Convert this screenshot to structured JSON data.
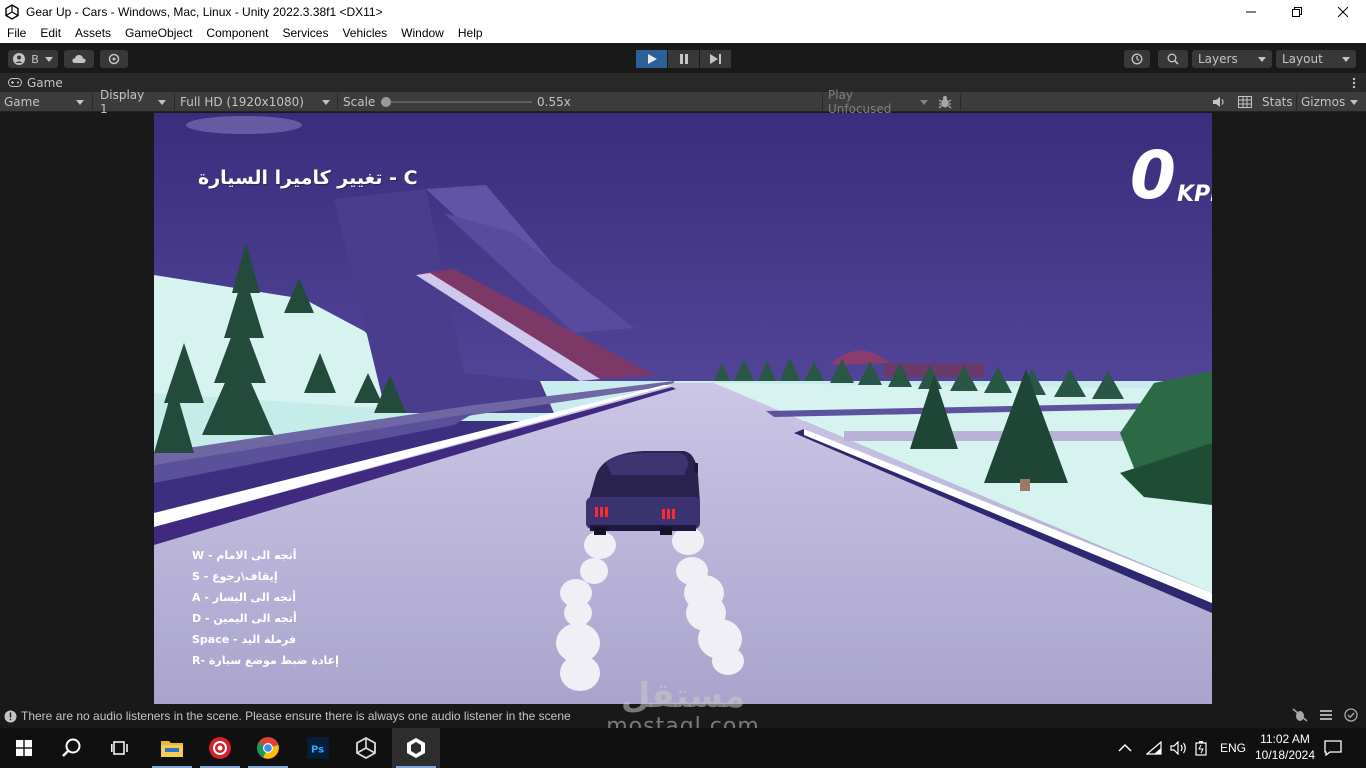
{
  "window": {
    "title": "Gear Up - Cars - Windows, Mac, Linux - Unity 2022.3.38f1 <DX11>"
  },
  "menu": [
    "File",
    "Edit",
    "Assets",
    "GameObject",
    "Component",
    "Services",
    "Vehicles",
    "Window",
    "Help"
  ],
  "toolbar": {
    "account_initial": "B",
    "layers_label": "Layers",
    "layout_label": "Layout"
  },
  "tab": {
    "label": "Game"
  },
  "gamebar": {
    "mode": "Game",
    "display": "Display 1",
    "resolution": "Full HD (1920x1080)",
    "scale_label": "Scale",
    "scale_value": "0.55x",
    "play_focus": "Play Unfocused",
    "stats": "Stats",
    "gizmos": "Gizmos"
  },
  "hud": {
    "camera_hint": "تغيير كاميرا السيارة - C",
    "speed_value": "0",
    "speed_unit": "KPH",
    "controls": [
      {
        "key": "W",
        "action": "أتجه الى الامام"
      },
      {
        "key": "S",
        "action": "إيقاف\\رجوع"
      },
      {
        "key": "A",
        "action": "أتجه الى اليسار"
      },
      {
        "key": "D",
        "action": "أتجه الى اليمين"
      },
      {
        "key": "Space",
        "action": "فرملة اليد"
      },
      {
        "key": "R",
        "action": "إعادة ضبط موضع سيارة"
      }
    ]
  },
  "status": {
    "message": "There are no audio listeners in the scene. Please ensure there is always one audio listener in the scene"
  },
  "watermark": {
    "arabic": "مستقل",
    "latin": "mostaql.com"
  },
  "taskbar": {
    "language": "ENG",
    "time": "11:02 AM",
    "date": "10/18/2024"
  },
  "colors": {
    "sky": "#3d2f80",
    "road": "#b9b4d8",
    "snow": "#d5f2f0",
    "tree": "#234a3c",
    "play_active": "#2d5f9a",
    "taillight": "#ff2a2a"
  }
}
